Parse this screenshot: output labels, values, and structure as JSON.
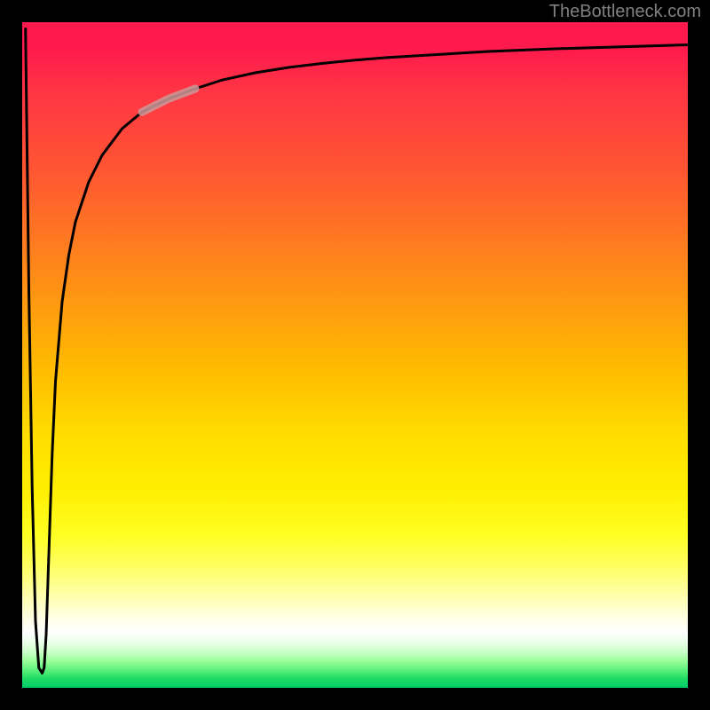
{
  "attribution": "TheBottleneck.com",
  "chart_data": {
    "type": "line",
    "title": "",
    "xlabel": "",
    "ylabel": "",
    "xlim": [
      0,
      100
    ],
    "ylim": [
      0,
      100
    ],
    "series": [
      {
        "name": "curve",
        "x": [
          0.5,
          1.0,
          1.5,
          2.0,
          2.5,
          3.0,
          3.3,
          3.6,
          4.0,
          4.5,
          5.0,
          6.0,
          7.0,
          8.0,
          10.0,
          12.0,
          15.0,
          18.0,
          22.0,
          26.0,
          30.0,
          35.0,
          40.0,
          45.0,
          50.0,
          55.0,
          60.0,
          70.0,
          80.0,
          90.0,
          100.0
        ],
        "y": [
          99.0,
          60.0,
          30.0,
          10.0,
          3.0,
          2.2,
          3.0,
          8.0,
          20.0,
          35.0,
          46.0,
          58.0,
          65.0,
          70.0,
          76.0,
          80.0,
          84.0,
          86.5,
          88.5,
          90.0,
          91.3,
          92.4,
          93.2,
          93.8,
          94.3,
          94.7,
          95.0,
          95.6,
          96.0,
          96.3,
          96.6
        ]
      }
    ],
    "highlight_segment": {
      "x_start": 18.0,
      "x_end": 26.0,
      "color": "#cc9999"
    },
    "background_gradient": {
      "type": "vertical",
      "stops": [
        {
          "pos": 0,
          "color": "#ff1a4d"
        },
        {
          "pos": 50,
          "color": "#ffbb00"
        },
        {
          "pos": 75,
          "color": "#ffff33"
        },
        {
          "pos": 92,
          "color": "#ffffff"
        },
        {
          "pos": 100,
          "color": "#00cc66"
        }
      ]
    }
  }
}
